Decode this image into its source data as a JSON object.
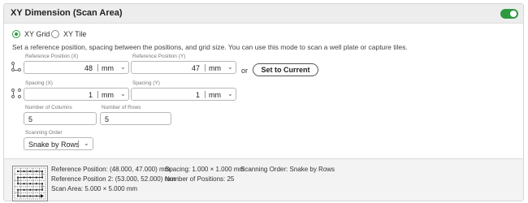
{
  "header": {
    "title": "XY Dimension (Scan Area)",
    "enabled": true,
    "toggle_color": "#2e9a3f"
  },
  "mode": {
    "options": [
      {
        "label": "XY Grid",
        "selected": true
      },
      {
        "label": "XY Tile",
        "selected": false
      }
    ]
  },
  "description": "Set a reference position, spacing between the positions, and grid size. You can use this mode to scan a well plate or capture tiles.",
  "reference_position": {
    "x": {
      "label": "Reference Position (X)",
      "value": "48",
      "unit": "mm"
    },
    "y": {
      "label": "Reference Position (Y)",
      "value": "47",
      "unit": "mm"
    },
    "or_text": "or",
    "set_button": "Set to Current"
  },
  "spacing": {
    "x": {
      "label": "Spacing (X)",
      "value": "1",
      "unit": "mm"
    },
    "y": {
      "label": "Spacing (Y)",
      "value": "1",
      "unit": "mm"
    }
  },
  "grid": {
    "columns": {
      "label": "Number of Columns",
      "value": "5"
    },
    "rows": {
      "label": "Number of Rows",
      "value": "5"
    }
  },
  "scanning_order": {
    "label": "Scanning Order",
    "value": "Snake by Rows"
  },
  "summary": {
    "reference_position": "Reference Position: (48.000, 47.000) mm",
    "reference_position_2": "Reference Position 2: (53.000, 52.000) mm",
    "scan_area": "Scan Area: 5.000 × 5.000 mm",
    "spacing": "Spacing: 1.000 × 1.000 mm",
    "num_positions": "Number of Positions: 25",
    "scanning_order": "Scanning Order: Snake by Rows"
  },
  "icons": {
    "toggle": "toggle-switch-icon",
    "reference_icon": "reference-position-icon",
    "spacing_icon": "spacing-grid-icon",
    "dropdown": "chevron-down-icon",
    "preview": "snake-grid-preview-icon"
  }
}
